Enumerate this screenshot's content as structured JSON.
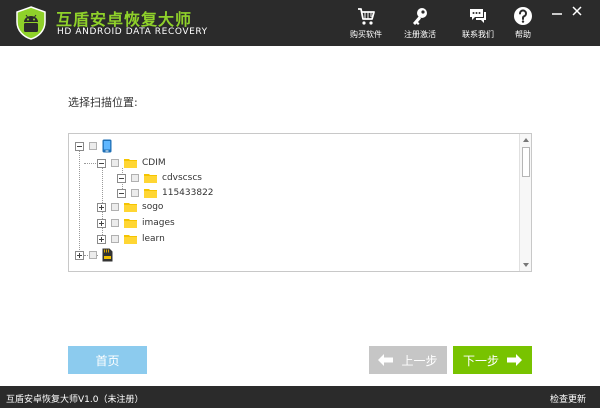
{
  "app": {
    "title": "互盾安卓恢复大师",
    "subtitle": "HD ANDROID DATA RECOVERY"
  },
  "nav": {
    "buy": "购买软件",
    "register": "注册激活",
    "contact": "联系我们",
    "help": "帮助"
  },
  "main": {
    "scan_location_label": "选择扫描位置:"
  },
  "tree": {
    "items": [
      "CDIM",
      "cdvscscs",
      "115433822",
      "sogo",
      "images",
      "learn"
    ]
  },
  "buttons": {
    "home": "首页",
    "prev": "上一步",
    "next": "下一步"
  },
  "footer": {
    "version": "互盾安卓恢复大师V1.0（未注册）",
    "update": "检查更新"
  },
  "colors": {
    "header_bg": "#2b2b2b",
    "brand_green": "#8fd12a",
    "home_button": "#8ccbee",
    "prev_button": "#c6c6c6",
    "next_button": "#78c300",
    "folder": "#f5c400"
  }
}
